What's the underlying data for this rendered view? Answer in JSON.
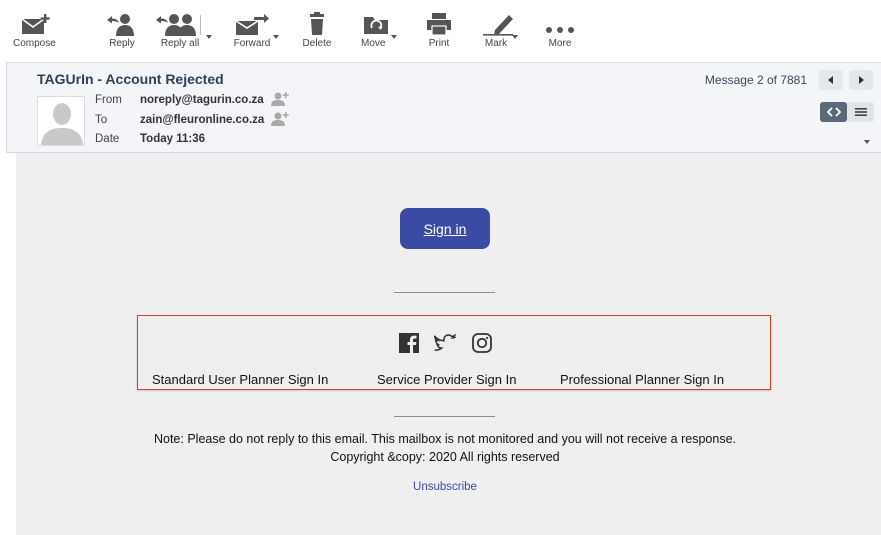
{
  "toolbar": {
    "compose": "Compose",
    "reply": "Reply",
    "reply_all": "Reply all",
    "forward": "Forward",
    "delete": "Delete",
    "move": "Move",
    "print": "Print",
    "mark": "Mark",
    "more": "More"
  },
  "header": {
    "subject": "TAGUrIn - Account Rejected",
    "from_label": "From",
    "from_value": "noreply@tagurin.co.za",
    "to_label": "To",
    "to_value": "zain@fleuronline.co.za",
    "date_label": "Date",
    "date_value": "Today 11:36",
    "message_counter": "Message 2 of 7881"
  },
  "email": {
    "signin_label": "Sign in",
    "links": [
      "Standard User Planner Sign In",
      "Service Provider Sign In",
      "Professional Planner Sign In"
    ],
    "note": "Note: Please do not reply to this email. This mailbox is not monitored and you will not receive a response.",
    "copyright": "Copyright &copy: 2020 All rights reserved",
    "unsubscribe": "Unsubscribe"
  },
  "colors": {
    "accent": "#3a4aa5",
    "highlight_border": "#d23a2a",
    "header_bg": "#f3f5f8",
    "body_bg": "#f0efef"
  },
  "icons": [
    "compose-icon",
    "reply-icon",
    "reply-all-icon",
    "forward-icon",
    "delete-icon",
    "move-icon",
    "print-icon",
    "mark-icon",
    "more-icon",
    "facebook-icon",
    "twitter-icon",
    "instagram-icon"
  ]
}
